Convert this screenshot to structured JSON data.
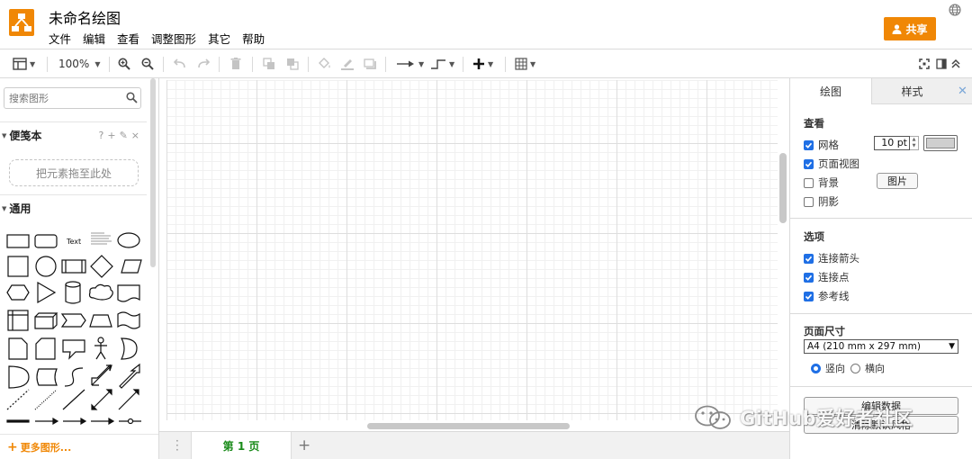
{
  "app": {
    "title": "未命名绘图",
    "menu": [
      "文件",
      "编辑",
      "查看",
      "调整图形",
      "其它",
      "帮助"
    ],
    "share_label": "共享",
    "brand_color": "#f08705"
  },
  "toolbar": {
    "zoom": "100%",
    "icons": [
      "format-panel-icon",
      "zoom-in-icon",
      "zoom-out-icon",
      "undo-icon",
      "redo-icon",
      "delete-icon",
      "to-front-icon",
      "to-back-icon",
      "fill-color-icon",
      "line-color-icon",
      "shadow-icon",
      "connection-icon",
      "waypoints-icon",
      "insert-icon",
      "table-icon",
      "fullscreen-icon",
      "format-toggle-icon",
      "collapse-icon"
    ]
  },
  "sidebar": {
    "search_placeholder": "搜索图形",
    "scratchpad": {
      "title": "便笺本",
      "tools": [
        "?",
        "+",
        "✎",
        "×"
      ],
      "dropzone": "把元素拖至此处"
    },
    "general": {
      "title": "通用",
      "text_shape_label": "Text"
    },
    "more_shapes": "更多图形..."
  },
  "pages": {
    "tabs": [
      "第 1 页"
    ]
  },
  "format_panel": {
    "tabs": [
      "绘图",
      "样式"
    ],
    "view": {
      "title": "查看",
      "grid": {
        "label": "网格",
        "checked": true,
        "size": "10 pt"
      },
      "page_view": {
        "label": "页面视图",
        "checked": true
      },
      "background": {
        "label": "背景",
        "checked": false,
        "button": "图片"
      },
      "shadow": {
        "label": "阴影",
        "checked": false
      }
    },
    "options": {
      "title": "选项",
      "items": [
        {
          "label": "连接箭头",
          "checked": true
        },
        {
          "label": "连接点",
          "checked": true
        },
        {
          "label": "参考线",
          "checked": true
        }
      ]
    },
    "page_size": {
      "title": "页面尺寸",
      "selected": "A4 (210 mm x 297 mm)",
      "portrait": "竖向",
      "landscape": "横向",
      "orientation": "portrait"
    },
    "buttons": [
      "编辑数据",
      "清除默认风格"
    ]
  },
  "watermark": {
    "text": "GitHub爱好者社区"
  }
}
